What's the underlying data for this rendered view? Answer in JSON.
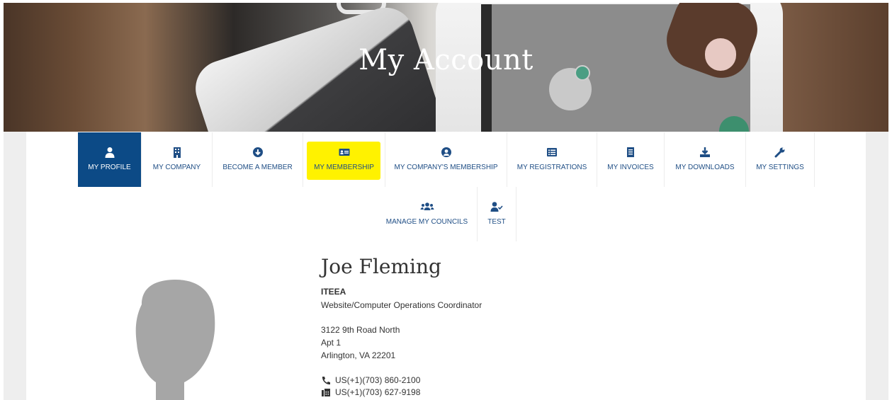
{
  "hero": {
    "title": "My Account"
  },
  "nav": {
    "tabs": [
      {
        "label": "MY PROFILE",
        "icon": "user-icon"
      },
      {
        "label": "MY COMPANY",
        "icon": "building-icon"
      },
      {
        "label": "BECOME A MEMBER",
        "icon": "arrow-down-circle-icon"
      },
      {
        "label": "MY MEMBERSHIP",
        "icon": "id-card-icon"
      },
      {
        "label": "MY COMPANY'S MEMBERSHIP",
        "icon": "user-circle-icon"
      },
      {
        "label": "MY REGISTRATIONS",
        "icon": "list-icon"
      },
      {
        "label": "MY INVOICES",
        "icon": "invoice-icon"
      },
      {
        "label": "MY DOWNLOADS",
        "icon": "download-icon"
      },
      {
        "label": "MY SETTINGS",
        "icon": "wrench-icon"
      },
      {
        "label": "MANAGE MY COUNCILS",
        "icon": "users-icon"
      },
      {
        "label": "TEST",
        "icon": "user-check-icon"
      }
    ],
    "active_tab": "MY PROFILE",
    "highlighted_tab": "MY MEMBERSHIP"
  },
  "profile": {
    "name": "Joe Fleming",
    "organization": "ITEEA",
    "title": "Website/Computer Operations Coordinator",
    "address_line1": "3122 9th Road North",
    "address_line2": "Apt 1",
    "city_state_zip": "Arlington, VA 22201",
    "phone": "US(+1)(703) 860-2100",
    "fax": "US(+1)(703) 627-9198"
  },
  "colors": {
    "active_tab_bg": "#0c4a86",
    "tab_text": "#1f4e85",
    "highlight": "#fff200"
  }
}
